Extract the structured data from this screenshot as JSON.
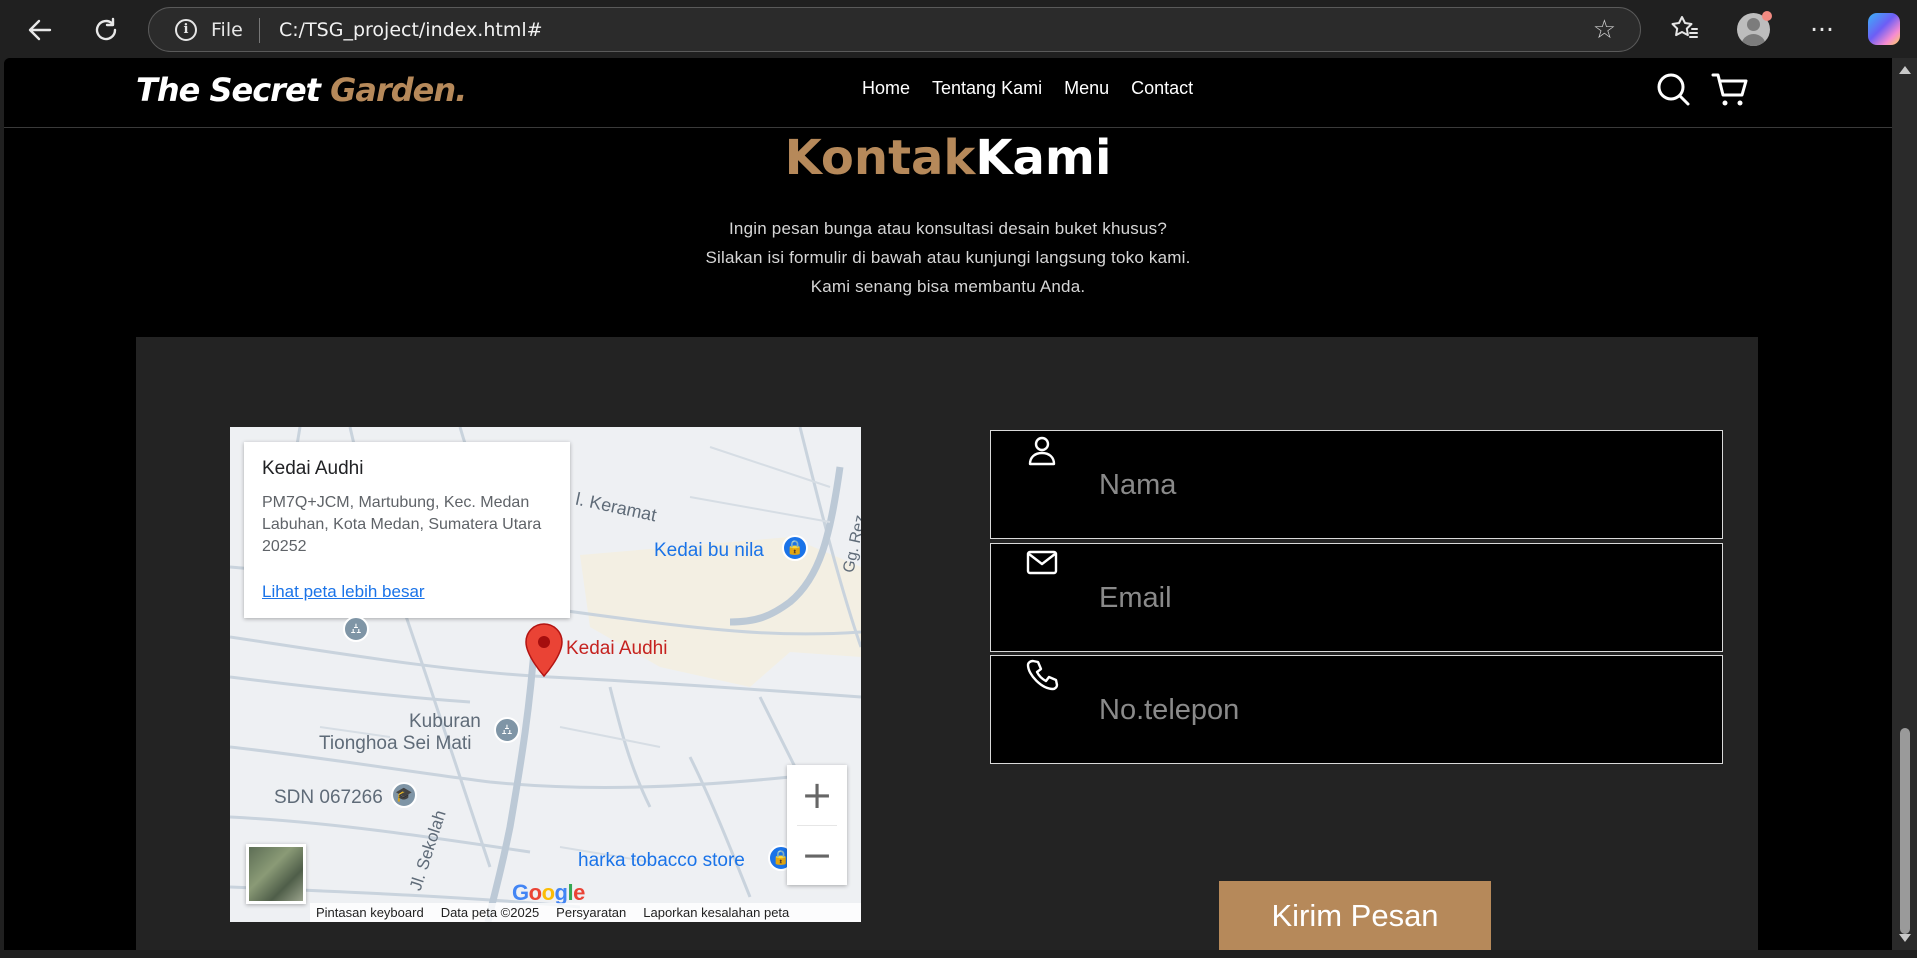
{
  "browser": {
    "scheme_label": "File",
    "url": "C:/TSG_project/index.html#",
    "icons": [
      "back-icon",
      "refresh-icon",
      "info-icon",
      "star-icon",
      "favorites-icon",
      "profile-avatar",
      "more-icon",
      "copilot-icon"
    ]
  },
  "site": {
    "logo_main": "The Secret ",
    "logo_accent": "Garden.",
    "nav": [
      "Home",
      "Tentang Kami",
      "Menu",
      "Contact"
    ],
    "icons": [
      "search-icon",
      "cart-icon"
    ],
    "accent_color": "#b6895a"
  },
  "contact": {
    "title_part1": "Kontak",
    "title_part2": "Kami",
    "subtitle_lines": [
      "Ingin pesan bunga atau konsultasi desain buket khusus?",
      "Silakan isi formulir di bawah atau kunjungi langsung toko kami.",
      "Kami senang bisa membantu Anda."
    ],
    "form": {
      "name_placeholder": "Nama",
      "email_placeholder": "Email",
      "phone_placeholder": "No.telepon",
      "submit_label": "Kirim Pesan"
    }
  },
  "map": {
    "place_name": "Kedai Audhi",
    "place_address": "PM7Q+JCM, Martubung, Kec. Medan Labuhan, Kota Medan, Sumatera Utara 20252",
    "view_larger": "Lihat peta lebih besar",
    "labels": {
      "marker": "Kedai Audhi",
      "kedai_bu_nila": "Kedai bu nila",
      "keramat": "l. Keramat",
      "gg_rezki": "Gg. Rez",
      "kuburan_1": "Kuburan",
      "kuburan_2": "Tionghoa Sei Mati",
      "sdn": "SDN 067266",
      "jl_sekolah": "Jl. Sekolah",
      "harka": "harka tobacco store"
    },
    "zoom_in": "+",
    "zoom_out": "−",
    "google_letters": [
      "G",
      "o",
      "o",
      "g",
      "l",
      "e"
    ],
    "attribution": [
      "Pintasan keyboard",
      "Data peta ©2025",
      "Persyaratan",
      "Laporkan kesalahan peta"
    ]
  }
}
